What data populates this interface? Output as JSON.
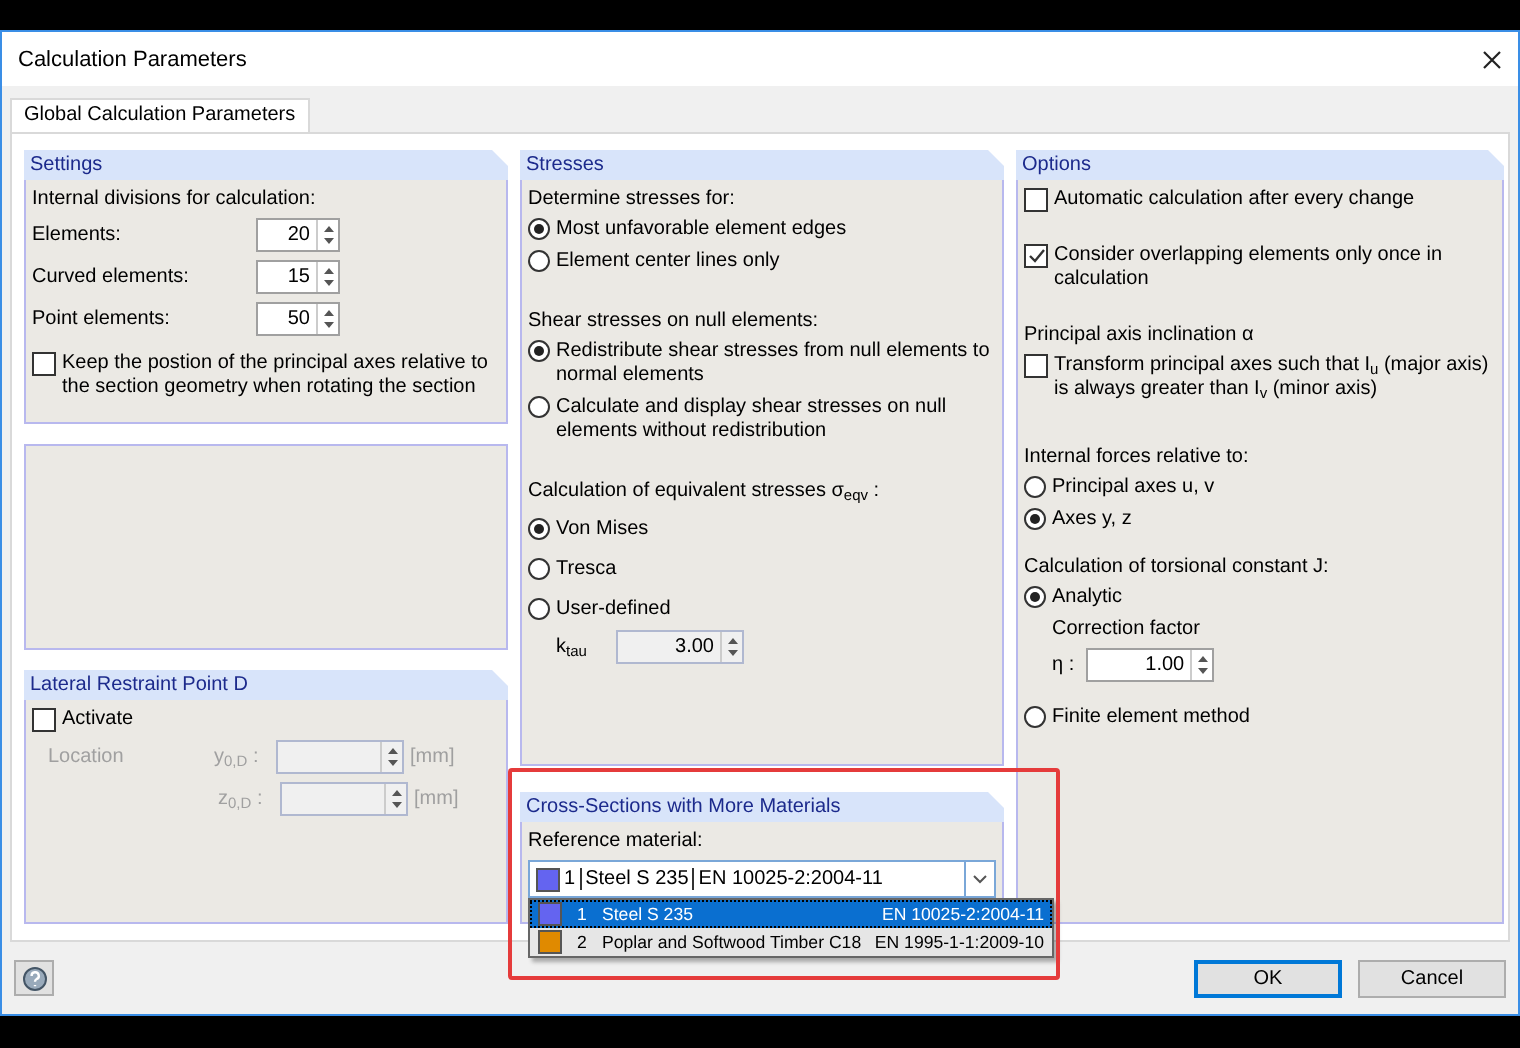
{
  "window": {
    "title": "Calculation Parameters"
  },
  "tabs": [
    {
      "label": "Global Calculation Parameters",
      "selected": true
    }
  ],
  "settings": {
    "title": "Settings",
    "heading": "Internal divisions for calculation:",
    "fields": [
      {
        "label": "Elements:",
        "value": "20"
      },
      {
        "label": "Curved elements:",
        "value": "15"
      },
      {
        "label": "Point elements:",
        "value": "50"
      }
    ],
    "keep_axes": {
      "label": "Keep the postion of the principal axes relative to the section geometry when rotating the section",
      "checked": false
    }
  },
  "lateral_restraint": {
    "title": "Lateral Restraint Point D",
    "activate": {
      "label": "Activate",
      "checked": false
    },
    "location_label": "Location",
    "fields": [
      {
        "label": "y$_{0,D}$ :",
        "unit": "[mm]",
        "disabled": true
      },
      {
        "label": "z$_{0,D}$ :",
        "unit": "[mm]",
        "disabled": true
      }
    ]
  },
  "stresses": {
    "title": "Stresses",
    "groups": [
      {
        "heading": "Determine stresses for:",
        "options": [
          {
            "label": "Most unfavorable element edges",
            "selected": true
          },
          {
            "label": "Element center lines only",
            "selected": false
          }
        ]
      },
      {
        "heading": "Shear stresses on null elements:",
        "options": [
          {
            "label": "Redistribute shear stresses from null elements to normal elements",
            "selected": true
          },
          {
            "label": "Calculate and display shear stresses on null elements without redistribution",
            "selected": false
          }
        ]
      },
      {
        "heading": "Calculation of equivalent stresses σ$_{eqv}$ :",
        "options": [
          {
            "label": "Von Mises",
            "selected": true
          },
          {
            "label": "Tresca",
            "selected": false
          },
          {
            "label": "User-defined",
            "selected": false
          }
        ],
        "field": {
          "label": "k$_{tau}$",
          "value": "3.00",
          "disabled": true
        }
      }
    ]
  },
  "cross_sections": {
    "title": "Cross-Sections with More Materials",
    "label": "Reference material:",
    "combo": {
      "number": "1",
      "name": "Steel S 235",
      "standard": "EN 10025-2:2004-11",
      "color": "#6464f0"
    },
    "list": [
      {
        "number": "1",
        "name": "Steel S 235",
        "standard": "EN 10025-2:2004-11",
        "color": "#6464f0",
        "selected": true
      },
      {
        "number": "2",
        "name": "Poplar and Softwood Timber C18",
        "standard": "EN 1995-1-1:2009-10",
        "color": "#e08a00",
        "selected": false
      }
    ]
  },
  "options": {
    "title": "Options",
    "checks": [
      {
        "label": "Automatic calculation after every change",
        "checked": false
      },
      {
        "label": "Consider overlapping elements only once in calculation",
        "checked": true
      }
    ],
    "axis": {
      "heading": "Principal axis inclination α",
      "check": {
        "label": "Transform principal axes such that I$_{u}$ (major axis) is always greater than I$_{v}$ (minor axis)",
        "checked": false
      }
    },
    "forces": {
      "heading": "Internal forces relative to:",
      "options": [
        {
          "label": "Principal axes u, v",
          "selected": false
        },
        {
          "label": "Axes y, z",
          "selected": true
        }
      ]
    },
    "torsion": {
      "heading": "Calculation of torsional constant J:",
      "options": [
        {
          "label": "Analytic",
          "selected": true
        },
        {
          "label": "Finite element method",
          "selected": false
        }
      ],
      "correction": {
        "label": "Correction factor",
        "symbol": "η :",
        "value": "1.00"
      }
    }
  },
  "buttons": [
    {
      "label": "OK",
      "default": true
    },
    {
      "label": "Cancel",
      "default": false
    }
  ]
}
